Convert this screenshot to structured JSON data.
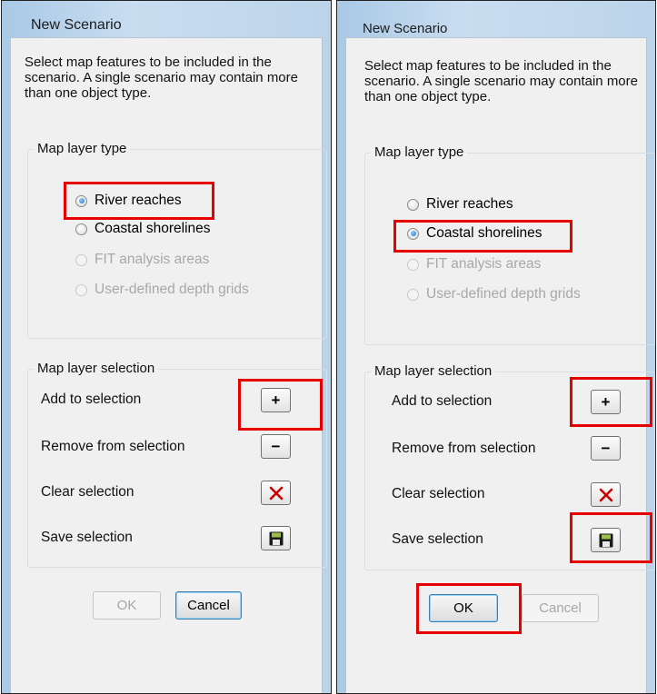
{
  "left": {
    "title": "New Scenario",
    "description": "Select map features to be included in the scenario.  A single scenario may contain more than one object type.",
    "layer_type_title": "Map layer type",
    "radios": [
      {
        "label": "River reaches",
        "checked": true,
        "enabled": true
      },
      {
        "label": "Coastal shorelines",
        "checked": false,
        "enabled": true
      },
      {
        "label": "FIT analysis areas",
        "checked": false,
        "enabled": false
      },
      {
        "label": "User-defined depth grids",
        "checked": false,
        "enabled": false
      }
    ],
    "selection_title": "Map layer selection",
    "actions": {
      "add": "Add to selection",
      "remove": "Remove from selection",
      "clear": "Clear selection",
      "save": "Save selection"
    },
    "ok": {
      "label": "OK",
      "enabled": false
    },
    "cancel": {
      "label": "Cancel",
      "enabled": true
    }
  },
  "right": {
    "title": "New Scenario",
    "description": "Select map features to be included in the scenario.  A single scenario may contain more than one object type.",
    "layer_type_title": "Map layer type",
    "radios": [
      {
        "label": "River reaches",
        "checked": false,
        "enabled": true
      },
      {
        "label": "Coastal shorelines",
        "checked": true,
        "enabled": true
      },
      {
        "label": "FIT analysis areas",
        "checked": false,
        "enabled": false
      },
      {
        "label": "User-defined depth grids",
        "checked": false,
        "enabled": false
      }
    ],
    "selection_title": "Map layer selection",
    "actions": {
      "add": "Add to selection",
      "remove": "Remove from selection",
      "clear": "Clear selection",
      "save": "Save selection"
    },
    "ok": {
      "label": "OK",
      "enabled": true
    },
    "cancel": {
      "label": "Cancel",
      "enabled": false
    }
  },
  "icons": {
    "add": "plus-icon",
    "remove": "minus-icon",
    "clear": "red-x-icon",
    "save": "floppy-disk-icon"
  },
  "colors": {
    "highlight": "#e60000",
    "clear_icon": "#cc0000",
    "radio_checked": "#1e6fc0",
    "disabled_text": "#a8a8a8"
  }
}
